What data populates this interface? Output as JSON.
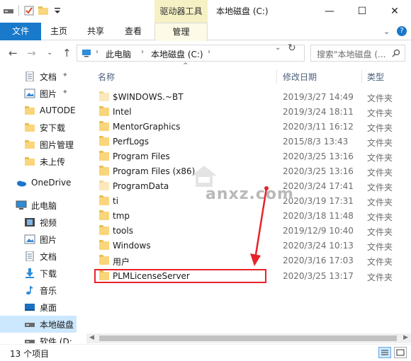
{
  "titlebar": {
    "context_tab": "驱动器工具",
    "title": "本地磁盘 (C:)",
    "minimize": "—",
    "maximize": "☐",
    "close": "✕"
  },
  "ribbon": {
    "file": "文件",
    "home": "主页",
    "share": "共享",
    "view": "查看",
    "manage": "管理",
    "collapse": "⌄",
    "help": "?"
  },
  "address": {
    "back": "←",
    "forward": "→",
    "recent": "⌄",
    "up": "↑",
    "crumbs": [
      "此电脑",
      "本地磁盘 (C:)"
    ],
    "sep": "›",
    "dropdown": "⌄",
    "refresh": "↻",
    "search_placeholder": "搜索\"本地磁盘 (..."
  },
  "nav": [
    {
      "label": "文档",
      "icon": "documents-icon",
      "pinned": true
    },
    {
      "label": "图片",
      "icon": "pictures-icon",
      "pinned": true
    },
    {
      "label": "AUTODE",
      "icon": "folder-icon",
      "pinned": false
    },
    {
      "label": "安下载",
      "icon": "folder-icon",
      "pinned": false
    },
    {
      "label": "图片管理",
      "icon": "folder-icon",
      "pinned": false
    },
    {
      "label": "未上传",
      "icon": "folder-icon",
      "pinned": false
    },
    {
      "label": "OneDrive",
      "icon": "onedrive-icon",
      "pinned": false
    },
    {
      "label": "此电脑",
      "icon": "this-pc-icon",
      "pinned": false
    },
    {
      "label": "视频",
      "icon": "videos-icon",
      "pinned": false
    },
    {
      "label": "图片",
      "icon": "pictures-icon",
      "pinned": false
    },
    {
      "label": "文档",
      "icon": "documents-icon",
      "pinned": false
    },
    {
      "label": "下载",
      "icon": "downloads-icon",
      "pinned": false
    },
    {
      "label": "音乐",
      "icon": "music-icon",
      "pinned": false
    },
    {
      "label": "桌面",
      "icon": "desktop-icon",
      "pinned": false
    },
    {
      "label": "本地磁盘",
      "icon": "drive-icon",
      "pinned": false
    },
    {
      "label": "软件 (D:",
      "icon": "drive-icon",
      "pinned": false
    }
  ],
  "columns": {
    "name": "名称",
    "date": "修改日期",
    "type": "类型",
    "sort_indicator": "^"
  },
  "files": [
    {
      "name": "$WINDOWS.~BT",
      "date": "2019/3/27 14:49",
      "type": "文件夹",
      "hidden": true
    },
    {
      "name": "Intel",
      "date": "2019/3/24 18:11",
      "type": "文件夹",
      "hidden": false
    },
    {
      "name": "MentorGraphics",
      "date": "2020/3/11 16:12",
      "type": "文件夹",
      "hidden": false
    },
    {
      "name": "PerfLogs",
      "date": "2015/8/3 13:43",
      "type": "文件夹",
      "hidden": false
    },
    {
      "name": "Program Files",
      "date": "2020/3/25 13:16",
      "type": "文件夹",
      "hidden": false
    },
    {
      "name": "Program Files (x86)",
      "date": "2020/3/25 13:16",
      "type": "文件夹",
      "hidden": false
    },
    {
      "name": "ProgramData",
      "date": "2020/3/24 17:41",
      "type": "文件夹",
      "hidden": true
    },
    {
      "name": "ti",
      "date": "2020/3/19 17:31",
      "type": "文件夹",
      "hidden": false
    },
    {
      "name": "tmp",
      "date": "2020/3/18 11:48",
      "type": "文件夹",
      "hidden": false
    },
    {
      "name": "tools",
      "date": "2019/12/9 10:40",
      "type": "文件夹",
      "hidden": false
    },
    {
      "name": "Windows",
      "date": "2020/3/24 10:13",
      "type": "文件夹",
      "hidden": false
    },
    {
      "name": "用户",
      "date": "2020/3/16 17:03",
      "type": "文件夹",
      "hidden": false
    },
    {
      "name": "PLMLicenseServer",
      "date": "2020/3/25 13:17",
      "type": "文件夹",
      "hidden": false
    }
  ],
  "watermark": "anxz.com",
  "status": {
    "count": "13 个项目"
  },
  "colors": {
    "accent": "#1979ca",
    "selection": "#cce8ff",
    "annotation": "#e8232a",
    "context_tab": "#f5f1c4"
  }
}
